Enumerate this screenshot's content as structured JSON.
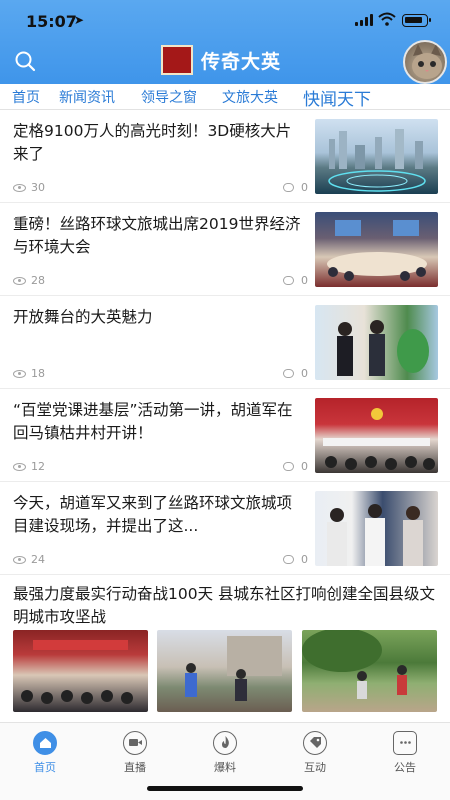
{
  "status_bar": {
    "time": "15:07"
  },
  "header": {
    "title": "传奇大英",
    "logo_text": "传奇大英"
  },
  "tabs": [
    {
      "label": "首页"
    },
    {
      "label": "新闻资讯"
    },
    {
      "label": "领导之窗"
    },
    {
      "label": "文旅大英"
    },
    {
      "label": "快闻天下"
    }
  ],
  "news": [
    {
      "title": "定格9100万人的高光时刻！3D硬核大片来了",
      "views": "30",
      "comments": "0"
    },
    {
      "title": "重磅！丝路环球文旅城出席2019世界经济与环境大会",
      "views": "28",
      "comments": "0"
    },
    {
      "title": "开放舞台的大英魅力",
      "views": "18",
      "comments": "0"
    },
    {
      "title": "“百堂党课进基层”活动第一讲，胡道军在回马镇枯井村开讲！",
      "views": "12",
      "comments": "0"
    },
    {
      "title": "今天，胡道军又来到了丝路环球文旅城项目建设现场，并提出了这...",
      "views": "24",
      "comments": "0"
    }
  ],
  "multi_news": {
    "title": "最强力度最实行动奋战100天 县城东社区打响创建全国县级文明城市攻坚战"
  },
  "bottom_nav": [
    {
      "label": "首页",
      "icon": "home-icon",
      "active": true
    },
    {
      "label": "直播",
      "icon": "video-icon",
      "active": false
    },
    {
      "label": "爆料",
      "icon": "flame-icon",
      "active": false
    },
    {
      "label": "互动",
      "icon": "tag-icon",
      "active": false
    },
    {
      "label": "公告",
      "icon": "announcement-icon",
      "active": false
    }
  ],
  "colors": {
    "header": "#4a9eee",
    "accent": "#2a7bd6",
    "active_nav": "#3f8fe6"
  }
}
